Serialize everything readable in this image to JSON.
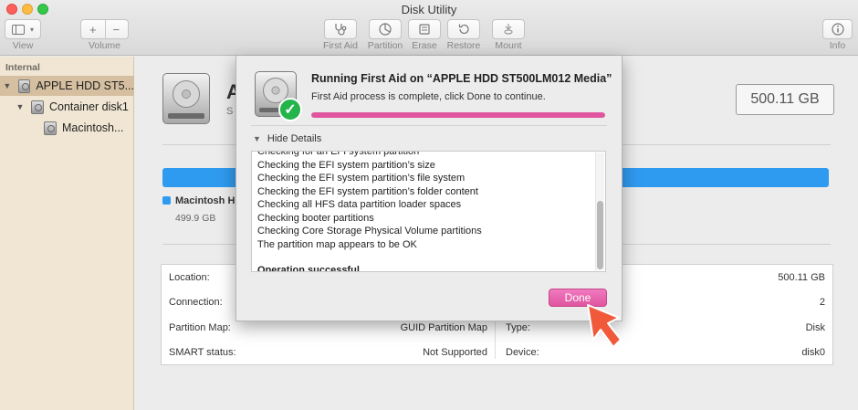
{
  "window": {
    "title": "Disk Utility"
  },
  "toolbar": {
    "view_label": "View",
    "volume_label": "Volume",
    "first_aid_label": "First Aid",
    "partition_label": "Partition",
    "erase_label": "Erase",
    "restore_label": "Restore",
    "mount_label": "Mount",
    "info_label": "Info"
  },
  "sidebar": {
    "header": "Internal",
    "items": [
      {
        "label": "APPLE HDD ST5..."
      },
      {
        "label": "Container disk1"
      },
      {
        "label": "Macintosh..."
      }
    ]
  },
  "main": {
    "disk_title": "A",
    "disk_sub": "S",
    "capacity": "500.11 GB",
    "legend_name": "Macintosh HD",
    "legend_size": "499.9 GB",
    "usage_color": "#2f9bf0"
  },
  "info": {
    "location_label": "Location:",
    "location_value": "500.11 GB",
    "connection_label": "Connection:",
    "connection_value": "2",
    "partition_map_label": "Partition Map:",
    "partition_map_value": "GUID Partition Map",
    "type_label": "Type:",
    "type_value": "Disk",
    "smart_label": "SMART status:",
    "smart_value": "Not Supported",
    "device_label": "Device:",
    "device_value": "disk0"
  },
  "sheet": {
    "title": "Running First Aid on “APPLE HDD ST500LM012 Media”",
    "message": "First Aid process is complete, click Done to continue.",
    "progress": 1.0,
    "progress_color": "#e0559e",
    "details_toggle": "Hide Details",
    "log_lines": [
      "Checking for an EFI system partition",
      "Checking the EFI system partition’s size",
      "Checking the EFI system partition’s file system",
      "Checking the EFI system partition’s folder content",
      "Checking all HFS data partition loader spaces",
      "Checking booter partitions",
      "Checking Core Storage Physical Volume partitions",
      "The partition map appears to be OK"
    ],
    "log_final": "Operation successful.",
    "done_label": "Done",
    "done_color": "#e0559e"
  },
  "icons": {
    "check": "✓",
    "arrow_color": "#f05a3a"
  }
}
